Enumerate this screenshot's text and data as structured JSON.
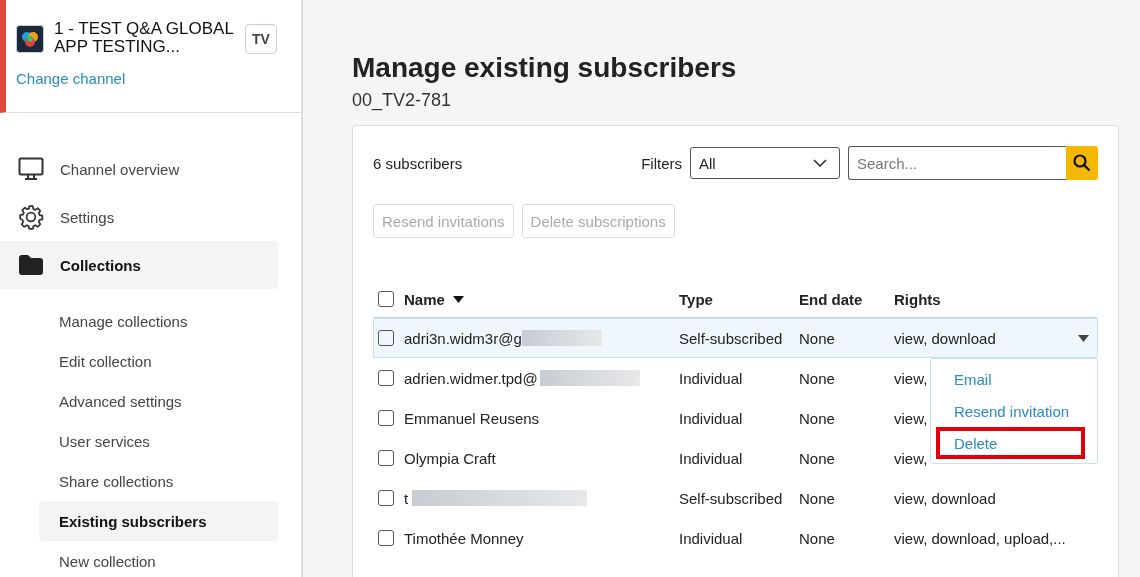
{
  "channel": {
    "name": "1 - TEST Q&A GLOBAL APP TESTING...",
    "badge": "TV",
    "change_link": "Change channel"
  },
  "nav": [
    {
      "label": "Channel overview",
      "kind": "monitor",
      "selected": false
    },
    {
      "label": "Settings",
      "kind": "gear",
      "selected": false
    },
    {
      "label": "Collections",
      "kind": "folder",
      "selected": true
    }
  ],
  "subnav": [
    {
      "label": "Manage collections",
      "selected": false
    },
    {
      "label": "Edit collection",
      "selected": false
    },
    {
      "label": "Advanced settings",
      "selected": false
    },
    {
      "label": "User services",
      "selected": false
    },
    {
      "label": "Share collections",
      "selected": false
    },
    {
      "label": "Existing subscribers",
      "selected": true
    },
    {
      "label": "New collection",
      "selected": false
    }
  ],
  "page": {
    "title": "Manage existing subscribers",
    "subtitle": "00_TV2-781"
  },
  "count": "6  subscribers",
  "filter": {
    "label": "Filters",
    "value": "All"
  },
  "search": {
    "placeholder": "Search..."
  },
  "actions": [
    {
      "label": "Resend invitations",
      "disabled": true
    },
    {
      "label": "Delete subscriptions",
      "disabled": true
    }
  ],
  "table": {
    "all_checked": false,
    "columns": [
      "Name",
      "Type",
      "End date",
      "Rights"
    ],
    "rows": [
      {
        "name": "adri3n.widm3r@g",
        "redacted": true,
        "type": "Self-subscribed",
        "end_date": "None",
        "rights": "view, download",
        "checked": false,
        "selected": true
      },
      {
        "name": "adrien.widmer.tpd@",
        "redacted": true,
        "type": "Individual",
        "end_date": "None",
        "rights": "view,",
        "checked": false,
        "selected": false
      },
      {
        "name": "Emmanuel Reusens",
        "redacted": false,
        "type": "Individual",
        "end_date": "None",
        "rights": "view,",
        "checked": false,
        "selected": false
      },
      {
        "name": "Olympia Craft",
        "redacted": false,
        "type": "Individual",
        "end_date": "None",
        "rights": "view,",
        "checked": false,
        "selected": false
      },
      {
        "name": "t",
        "redacted": true,
        "type": "Self-subscribed",
        "end_date": "None",
        "rights": "view, download",
        "checked": false,
        "selected": false
      },
      {
        "name": "Timothée Monney",
        "redacted": false,
        "type": "Individual",
        "end_date": "None",
        "rights": "view, download, upload,...",
        "checked": false,
        "selected": false
      }
    ]
  },
  "row_menu": [
    {
      "label": "Email",
      "highlighted": false
    },
    {
      "label": "Resend invitation",
      "highlighted": false
    },
    {
      "label": "Delete",
      "highlighted": true
    }
  ]
}
